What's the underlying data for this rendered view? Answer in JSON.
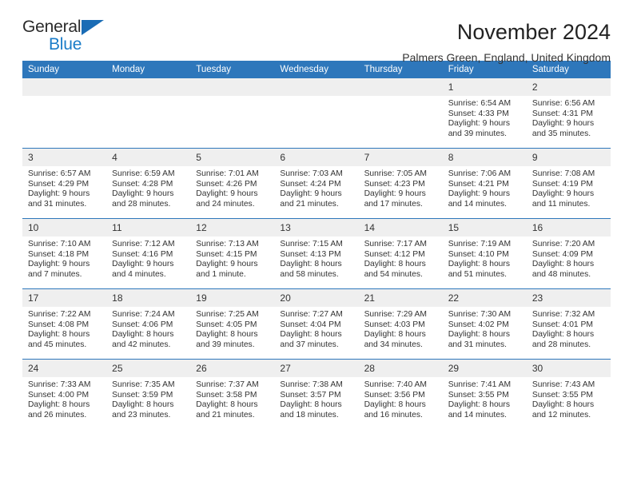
{
  "brand": {
    "name_top": "General",
    "name_bottom": "Blue",
    "triangle_color": "#1a6cb5",
    "blue_color": "#1a7cc8"
  },
  "header": {
    "month_title": "November 2024",
    "location": "Palmers Green, England, United Kingdom"
  },
  "theme": {
    "header_bg": "#2e77bb",
    "daynum_bg": "#efefef",
    "rule_color": "#2e77bb"
  },
  "weekday_headers": [
    "Sunday",
    "Monday",
    "Tuesday",
    "Wednesday",
    "Thursday",
    "Friday",
    "Saturday"
  ],
  "weeks": [
    [
      {
        "day": "",
        "sunrise": "",
        "sunset": "",
        "daylight1": "",
        "daylight2": ""
      },
      {
        "day": "",
        "sunrise": "",
        "sunset": "",
        "daylight1": "",
        "daylight2": ""
      },
      {
        "day": "",
        "sunrise": "",
        "sunset": "",
        "daylight1": "",
        "daylight2": ""
      },
      {
        "day": "",
        "sunrise": "",
        "sunset": "",
        "daylight1": "",
        "daylight2": ""
      },
      {
        "day": "",
        "sunrise": "",
        "sunset": "",
        "daylight1": "",
        "daylight2": ""
      },
      {
        "day": "1",
        "sunrise": "Sunrise: 6:54 AM",
        "sunset": "Sunset: 4:33 PM",
        "daylight1": "Daylight: 9 hours",
        "daylight2": "and 39 minutes."
      },
      {
        "day": "2",
        "sunrise": "Sunrise: 6:56 AM",
        "sunset": "Sunset: 4:31 PM",
        "daylight1": "Daylight: 9 hours",
        "daylight2": "and 35 minutes."
      }
    ],
    [
      {
        "day": "3",
        "sunrise": "Sunrise: 6:57 AM",
        "sunset": "Sunset: 4:29 PM",
        "daylight1": "Daylight: 9 hours",
        "daylight2": "and 31 minutes."
      },
      {
        "day": "4",
        "sunrise": "Sunrise: 6:59 AM",
        "sunset": "Sunset: 4:28 PM",
        "daylight1": "Daylight: 9 hours",
        "daylight2": "and 28 minutes."
      },
      {
        "day": "5",
        "sunrise": "Sunrise: 7:01 AM",
        "sunset": "Sunset: 4:26 PM",
        "daylight1": "Daylight: 9 hours",
        "daylight2": "and 24 minutes."
      },
      {
        "day": "6",
        "sunrise": "Sunrise: 7:03 AM",
        "sunset": "Sunset: 4:24 PM",
        "daylight1": "Daylight: 9 hours",
        "daylight2": "and 21 minutes."
      },
      {
        "day": "7",
        "sunrise": "Sunrise: 7:05 AM",
        "sunset": "Sunset: 4:23 PM",
        "daylight1": "Daylight: 9 hours",
        "daylight2": "and 17 minutes."
      },
      {
        "day": "8",
        "sunrise": "Sunrise: 7:06 AM",
        "sunset": "Sunset: 4:21 PM",
        "daylight1": "Daylight: 9 hours",
        "daylight2": "and 14 minutes."
      },
      {
        "day": "9",
        "sunrise": "Sunrise: 7:08 AM",
        "sunset": "Sunset: 4:19 PM",
        "daylight1": "Daylight: 9 hours",
        "daylight2": "and 11 minutes."
      }
    ],
    [
      {
        "day": "10",
        "sunrise": "Sunrise: 7:10 AM",
        "sunset": "Sunset: 4:18 PM",
        "daylight1": "Daylight: 9 hours",
        "daylight2": "and 7 minutes."
      },
      {
        "day": "11",
        "sunrise": "Sunrise: 7:12 AM",
        "sunset": "Sunset: 4:16 PM",
        "daylight1": "Daylight: 9 hours",
        "daylight2": "and 4 minutes."
      },
      {
        "day": "12",
        "sunrise": "Sunrise: 7:13 AM",
        "sunset": "Sunset: 4:15 PM",
        "daylight1": "Daylight: 9 hours",
        "daylight2": "and 1 minute."
      },
      {
        "day": "13",
        "sunrise": "Sunrise: 7:15 AM",
        "sunset": "Sunset: 4:13 PM",
        "daylight1": "Daylight: 8 hours",
        "daylight2": "and 58 minutes."
      },
      {
        "day": "14",
        "sunrise": "Sunrise: 7:17 AM",
        "sunset": "Sunset: 4:12 PM",
        "daylight1": "Daylight: 8 hours",
        "daylight2": "and 54 minutes."
      },
      {
        "day": "15",
        "sunrise": "Sunrise: 7:19 AM",
        "sunset": "Sunset: 4:10 PM",
        "daylight1": "Daylight: 8 hours",
        "daylight2": "and 51 minutes."
      },
      {
        "day": "16",
        "sunrise": "Sunrise: 7:20 AM",
        "sunset": "Sunset: 4:09 PM",
        "daylight1": "Daylight: 8 hours",
        "daylight2": "and 48 minutes."
      }
    ],
    [
      {
        "day": "17",
        "sunrise": "Sunrise: 7:22 AM",
        "sunset": "Sunset: 4:08 PM",
        "daylight1": "Daylight: 8 hours",
        "daylight2": "and 45 minutes."
      },
      {
        "day": "18",
        "sunrise": "Sunrise: 7:24 AM",
        "sunset": "Sunset: 4:06 PM",
        "daylight1": "Daylight: 8 hours",
        "daylight2": "and 42 minutes."
      },
      {
        "day": "19",
        "sunrise": "Sunrise: 7:25 AM",
        "sunset": "Sunset: 4:05 PM",
        "daylight1": "Daylight: 8 hours",
        "daylight2": "and 39 minutes."
      },
      {
        "day": "20",
        "sunrise": "Sunrise: 7:27 AM",
        "sunset": "Sunset: 4:04 PM",
        "daylight1": "Daylight: 8 hours",
        "daylight2": "and 37 minutes."
      },
      {
        "day": "21",
        "sunrise": "Sunrise: 7:29 AM",
        "sunset": "Sunset: 4:03 PM",
        "daylight1": "Daylight: 8 hours",
        "daylight2": "and 34 minutes."
      },
      {
        "day": "22",
        "sunrise": "Sunrise: 7:30 AM",
        "sunset": "Sunset: 4:02 PM",
        "daylight1": "Daylight: 8 hours",
        "daylight2": "and 31 minutes."
      },
      {
        "day": "23",
        "sunrise": "Sunrise: 7:32 AM",
        "sunset": "Sunset: 4:01 PM",
        "daylight1": "Daylight: 8 hours",
        "daylight2": "and 28 minutes."
      }
    ],
    [
      {
        "day": "24",
        "sunrise": "Sunrise: 7:33 AM",
        "sunset": "Sunset: 4:00 PM",
        "daylight1": "Daylight: 8 hours",
        "daylight2": "and 26 minutes."
      },
      {
        "day": "25",
        "sunrise": "Sunrise: 7:35 AM",
        "sunset": "Sunset: 3:59 PM",
        "daylight1": "Daylight: 8 hours",
        "daylight2": "and 23 minutes."
      },
      {
        "day": "26",
        "sunrise": "Sunrise: 7:37 AM",
        "sunset": "Sunset: 3:58 PM",
        "daylight1": "Daylight: 8 hours",
        "daylight2": "and 21 minutes."
      },
      {
        "day": "27",
        "sunrise": "Sunrise: 7:38 AM",
        "sunset": "Sunset: 3:57 PM",
        "daylight1": "Daylight: 8 hours",
        "daylight2": "and 18 minutes."
      },
      {
        "day": "28",
        "sunrise": "Sunrise: 7:40 AM",
        "sunset": "Sunset: 3:56 PM",
        "daylight1": "Daylight: 8 hours",
        "daylight2": "and 16 minutes."
      },
      {
        "day": "29",
        "sunrise": "Sunrise: 7:41 AM",
        "sunset": "Sunset: 3:55 PM",
        "daylight1": "Daylight: 8 hours",
        "daylight2": "and 14 minutes."
      },
      {
        "day": "30",
        "sunrise": "Sunrise: 7:43 AM",
        "sunset": "Sunset: 3:55 PM",
        "daylight1": "Daylight: 8 hours",
        "daylight2": "and 12 minutes."
      }
    ]
  ]
}
